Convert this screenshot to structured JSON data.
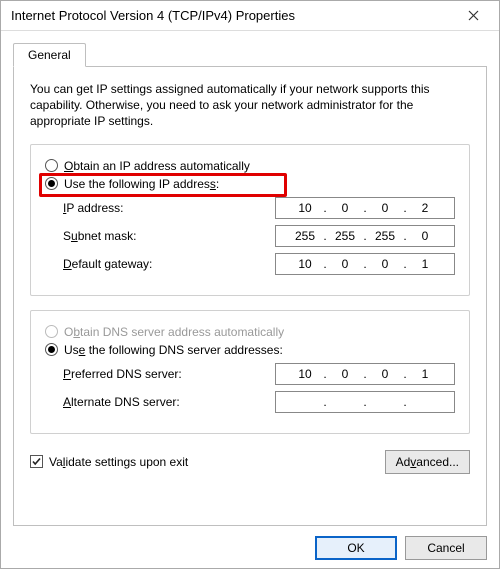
{
  "window": {
    "title": "Internet Protocol Version 4 (TCP/IPv4) Properties"
  },
  "tabs": {
    "general": "General"
  },
  "intro": "You can get IP settings assigned automatically if your network supports this capability. Otherwise, you need to ask your network administrator for the appropriate IP settings.",
  "ipGroup": {
    "autoLabelPre": "O",
    "autoLabelRest": "btain an IP address automatically",
    "manualLabelPre": "Use the following IP addres",
    "manualLabelU": "s",
    "manualLabelPost": ":",
    "ipAddr": {
      "labelU": "I",
      "labelRest": "P address:",
      "o1": "10",
      "o2": "0",
      "o3": "0",
      "o4": "2"
    },
    "subnet": {
      "labelPre": "S",
      "labelU": "u",
      "labelRest": "bnet mask:",
      "o1": "255",
      "o2": "255",
      "o3": "255",
      "o4": "0"
    },
    "gateway": {
      "labelU": "D",
      "labelRest": "efault gateway:",
      "o1": "10",
      "o2": "0",
      "o3": "0",
      "o4": "1"
    }
  },
  "dnsGroup": {
    "autoLabelPre": "O",
    "autoLabelU": "b",
    "autoLabelRest": "tain DNS server address automatically",
    "manualLabelPre": "Us",
    "manualLabelU": "e",
    "manualLabelRest": " the following DNS server addresses:",
    "preferred": {
      "labelU": "P",
      "labelRest": "referred DNS server:",
      "o1": "10",
      "o2": "0",
      "o3": "0",
      "o4": "1"
    },
    "alternate": {
      "labelU": "A",
      "labelRest": "lternate DNS server:",
      "o1": "",
      "o2": "",
      "o3": "",
      "o4": ""
    }
  },
  "validate": {
    "labelPre": "Va",
    "labelU": "l",
    "labelRest": "idate settings upon exit"
  },
  "buttons": {
    "advancedPre": "Ad",
    "advancedU": "v",
    "advancedRest": "anced...",
    "ok": "OK",
    "cancel": "Cancel"
  }
}
